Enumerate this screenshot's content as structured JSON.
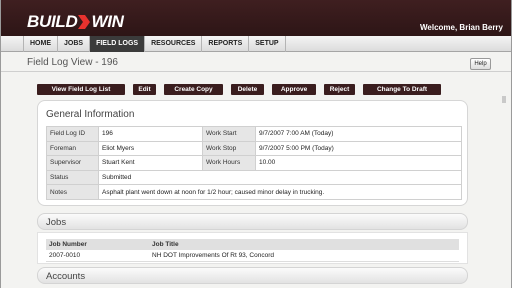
{
  "app": {
    "logo_left": "BUILD",
    "logo_right": "WIN",
    "welcome": "Welcome, Brian Berry",
    "brand_color": "#3a1d1e"
  },
  "nav": {
    "tabs": [
      {
        "label": "HOME",
        "active": false
      },
      {
        "label": "JOBS",
        "active": false
      },
      {
        "label": "FIELD LOGS",
        "active": true
      },
      {
        "label": "RESOURCES",
        "active": false
      },
      {
        "label": "REPORTS",
        "active": false
      },
      {
        "label": "SETUP",
        "active": false
      }
    ]
  },
  "page": {
    "title": "Field Log View - 196",
    "help_label": "Help"
  },
  "actions": {
    "view_list": "View Field Log List",
    "edit": "Edit",
    "create_copy": "Create Copy",
    "delete": "Delete",
    "approve": "Approve",
    "reject": "Reject",
    "change_to_draft": "Change To Draft"
  },
  "general": {
    "title": "General Information",
    "field_log_id_label": "Field Log ID",
    "field_log_id": "196",
    "work_start_label": "Work Start",
    "work_start": "9/7/2007 7:00 AM (Today)",
    "foreman_label": "Foreman",
    "foreman": "Eliot Myers",
    "work_stop_label": "Work Stop",
    "work_stop": "9/7/2007 5:00 PM (Today)",
    "supervisor_label": "Supervisor",
    "supervisor": "Stuart Kent",
    "work_hours_label": "Work Hours",
    "work_hours": "10.00",
    "status_label": "Status",
    "status": "Submitted",
    "notes_label": "Notes",
    "notes": "Asphalt plant went down at noon for 1/2 hour; caused minor delay in trucking."
  },
  "jobs": {
    "title": "Jobs",
    "col_number": "Job Number",
    "col_title": "Job Title",
    "rows": [
      {
        "number": "2007-0010",
        "title": "NH DOT Improvements Of Rt 93, Concord"
      }
    ]
  },
  "accounts": {
    "title": "Accounts"
  }
}
